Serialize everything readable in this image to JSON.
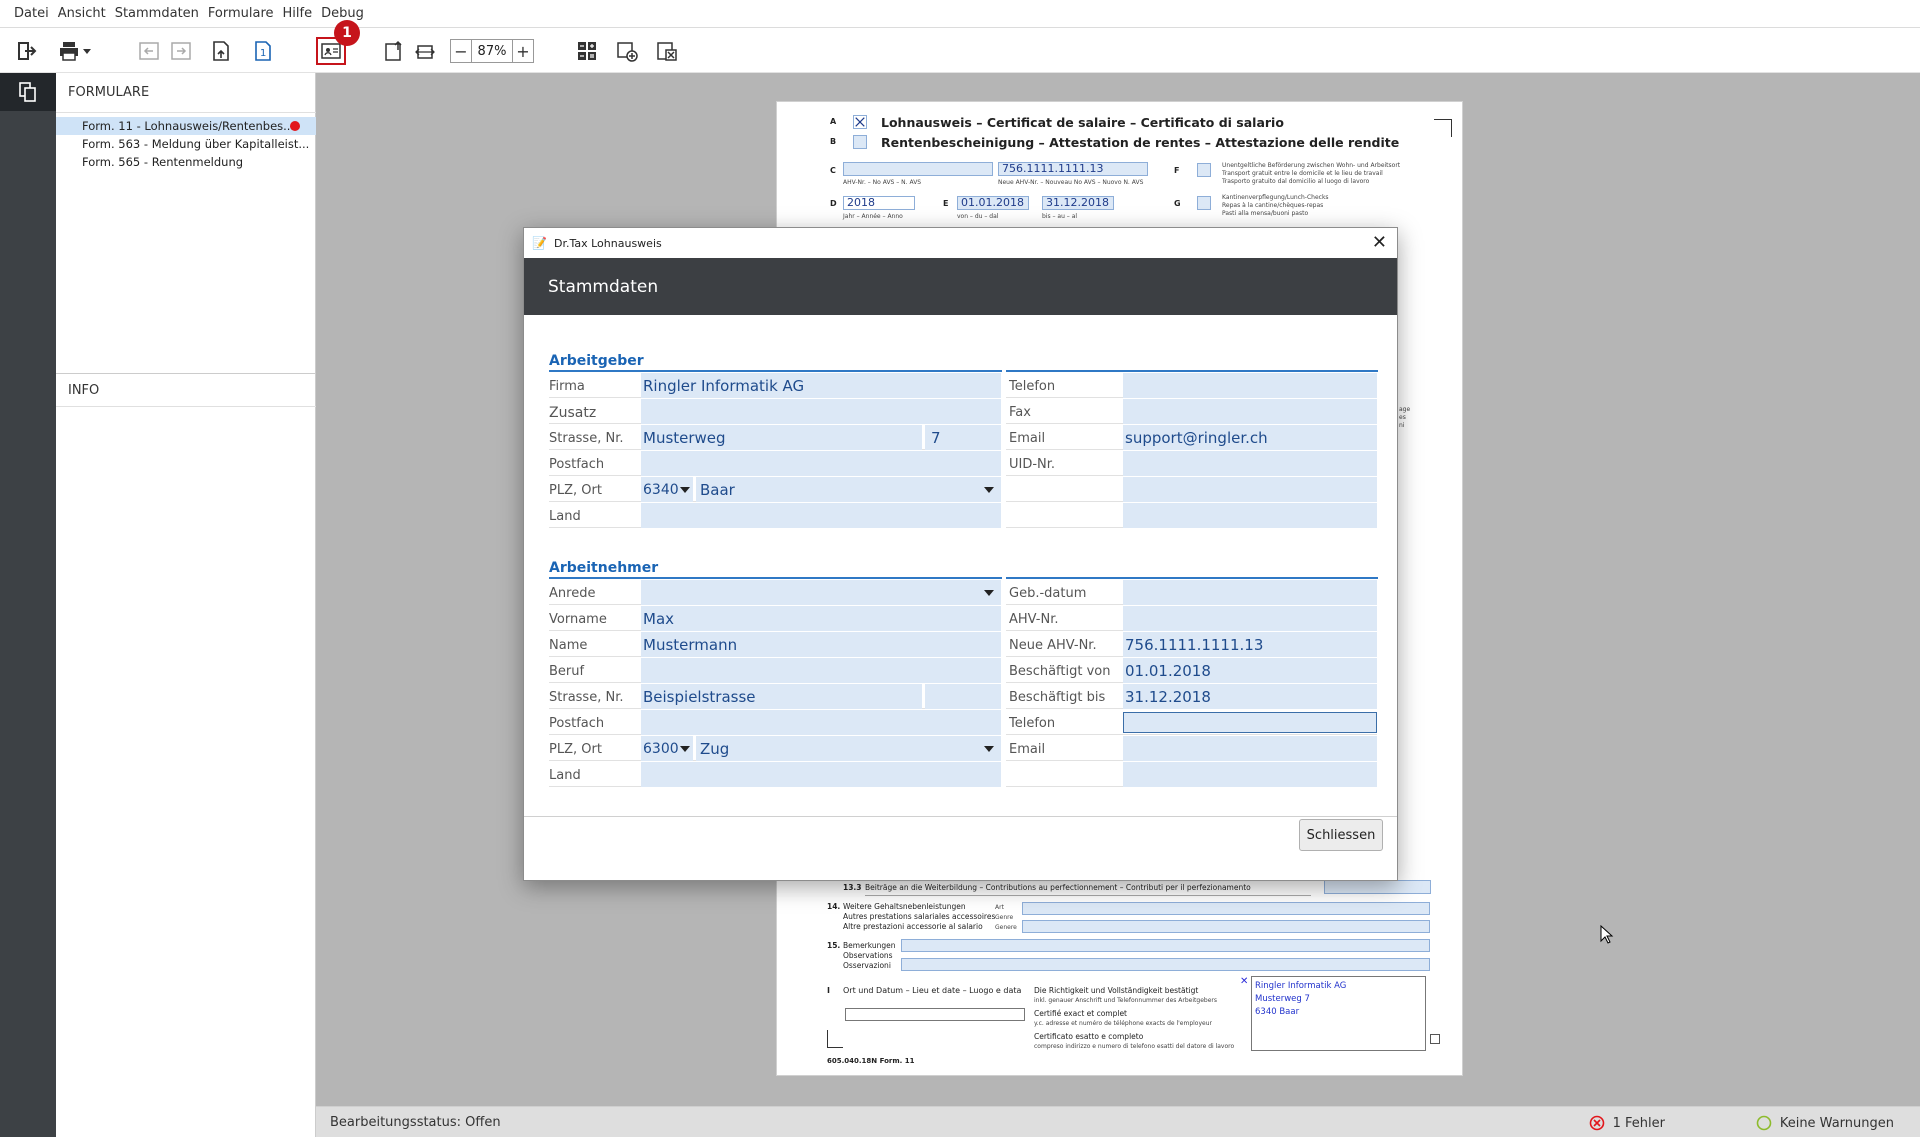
{
  "menu": {
    "items": [
      "Datei",
      "Ansicht",
      "Stammdaten",
      "Formulare",
      "Hilfe",
      "Debug"
    ]
  },
  "toolbar": {
    "zoom": "87%",
    "badge": "1"
  },
  "sidebar": {
    "forms_title": "FORMULARE",
    "forms": [
      "Form. 11 - Lohnausweis/Rentenbes...",
      "Form. 563 - Meldung über Kapitalleist...",
      "Form. 565 - Rentenmeldung"
    ],
    "info_title": "INFO"
  },
  "document": {
    "row_a_letter": "A",
    "row_b_letter": "B",
    "row_c_letter": "C",
    "row_d_letter": "D",
    "row_e_letter": "E",
    "row_f_letter": "F",
    "row_g_letter": "G",
    "title_a": "Lohnausweis – Certificat de salaire – Certificato di salario",
    "title_b": "Rentenbescheinigung – Attestation de rentes – Attestazione delle rendite",
    "ahv_caption": "AHV-Nr. – No AVS – N. AVS",
    "neue_ahv_caption": "Neue AHV-Nr. – Nouveau No AVS – Nuovo N. AVS",
    "ahv_value": "756.1111.1111.13",
    "year_value": "2018",
    "year_caption": "Jahr – Année – Anno",
    "from_value": "01.01.2018",
    "from_caption": "von – du – dal",
    "to_value": "31.12.2018",
    "to_caption": "bis – au – al",
    "f_text_1": "Unentgeltliche Beförderung zwischen Wohn- und Arbeitsort",
    "f_text_2": "Transport gratuit entre le domicile et le lieu de travail",
    "f_text_3": "Trasporto gratuito dal domicilio al luogo di lavoro",
    "g_text_1": "Kantinenverpflegung/Lunch-Checks",
    "g_text_2": "Repas à la cantine/chèques-repas",
    "g_text_3": "Pasti alla mensa/buoni pasto",
    "side_text_1": "age",
    "side_text_2": "es",
    "side_text_3": "ni",
    "row133_num": "13.3",
    "row133_text": "Beiträge an die Weiterbildung – Contributions au perfectionnement – Contributi per il perfezionamento",
    "row14_num": "14.",
    "row14_l1": "Weitere Gehaltsnebenleistungen",
    "row14_l2": "Autres prestations salariales accessoires",
    "row14_l3": "Altre prestazioni accessorie al salario",
    "row14_a1": "Art",
    "row14_a2": "Genre",
    "row14_a3": "Genere",
    "row15_num": "15.",
    "row15_l1": "Bemerkungen",
    "row15_l2": "Observations",
    "row15_l3": "Osservazioni",
    "row_i_letter": "I",
    "row_i_text": "Ort und Datum – Lieu et date – Luogo e data",
    "confirm_1": "Die Richtigkeit und Vollständigkeit bestätigt",
    "confirm_1b": "inkl. genauer Anschrift und Telefonnummer des Arbeitgebers",
    "confirm_2": "Certifié exact et complet",
    "confirm_2b": "y.c. adresse et numéro de téléphone exacts de l'employeur",
    "confirm_3": "Certificato esatto e completo",
    "confirm_3b": "compreso indirizzo e numero di telefono esatti del datore di lavoro",
    "stamp_1": "Ringler Informatik AG",
    "stamp_2": "Musterweg 7",
    "stamp_3": "6340 Baar",
    "footer": "605.040.18N   Form. 11"
  },
  "dialog": {
    "window_title": "Dr.Tax Lohnausweis",
    "header": "Stammdaten",
    "employer_title": "Arbeitgeber",
    "employee_title": "Arbeitnehmer",
    "close_button": "Schliessen",
    "employer": {
      "firma_label": "Firma",
      "firma": "Ringler Informatik AG",
      "zusatz_label": "Zusatz",
      "zusatz": "",
      "strasse_label": "Strasse, Nr.",
      "strasse": "Musterweg",
      "nr": "7",
      "postfach_label": "Postfach",
      "postfach": "",
      "plz_label": "PLZ, Ort",
      "plz": "6340",
      "ort": "Baar",
      "land_label": "Land",
      "land": "",
      "telefon_label": "Telefon",
      "telefon": "",
      "fax_label": "Fax",
      "fax": "",
      "email_label": "Email",
      "email": "support@ringler.ch",
      "uid_label": "UID-Nr.",
      "uid": ""
    },
    "employee": {
      "anrede_label": "Anrede",
      "anrede": "",
      "vorname_label": "Vorname",
      "vorname": "Max",
      "name_label": "Name",
      "name": "Mustermann",
      "beruf_label": "Beruf",
      "beruf": "",
      "strasse_label": "Strasse, Nr.",
      "strasse": "Beispielstrasse",
      "nr": "",
      "postfach_label": "Postfach",
      "postfach": "",
      "plz_label": "PLZ, Ort",
      "plz": "6300",
      "ort": "Zug",
      "land_label": "Land",
      "land": "",
      "gebdatum_label": "Geb.-datum",
      "gebdatum": "",
      "ahv_label": "AHV-Nr.",
      "ahv": "",
      "neue_ahv_label": "Neue AHV-Nr.",
      "neue_ahv": "756.1111.1111.13",
      "von_label": "Beschäftigt von",
      "von": "01.01.2018",
      "bis_label": "Beschäftigt bis",
      "bis": "31.12.2018",
      "telefon_label": "Telefon",
      "telefon": "",
      "email_label": "Email",
      "email": ""
    }
  },
  "status": {
    "bearbeitungsstatus": "Bearbeitungsstatus: Offen",
    "errors": "1 Fehler",
    "warnings": "Keine Warnungen"
  },
  "colors": {
    "accent": "#1a64b4",
    "error": "#e2151b",
    "ok": "#8dbb2c",
    "field": "#dce8f6"
  }
}
